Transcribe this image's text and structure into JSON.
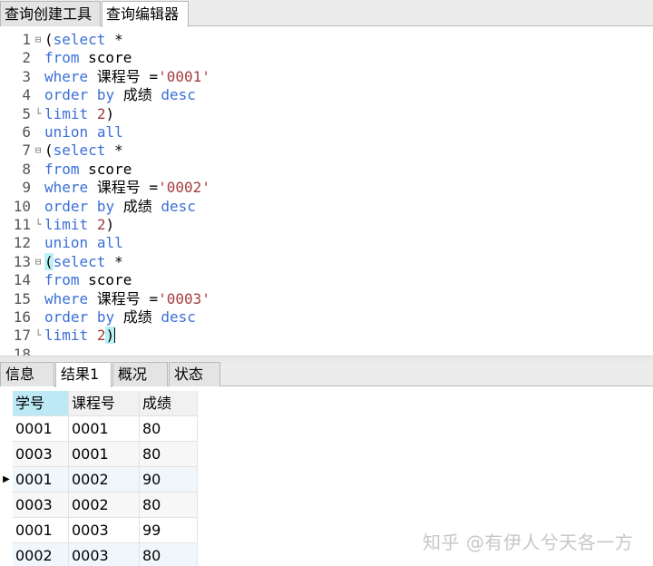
{
  "top_tabs": [
    {
      "label": "查询创建工具",
      "active": false
    },
    {
      "label": "查询编辑器",
      "active": true
    }
  ],
  "editor": {
    "lines": [
      {
        "n": "1",
        "fold": "⊟",
        "segs": [
          [
            "p",
            "("
          ],
          [
            "kw",
            "select"
          ],
          [
            "p",
            " *"
          ]
        ]
      },
      {
        "n": "2",
        "fold": "",
        "segs": [
          [
            "kw",
            "from"
          ],
          [
            "p",
            " score"
          ]
        ]
      },
      {
        "n": "3",
        "fold": "",
        "segs": [
          [
            "kw",
            "where"
          ],
          [
            "p",
            " 课程号 ="
          ],
          [
            "str",
            "'0001'"
          ]
        ]
      },
      {
        "n": "4",
        "fold": "",
        "segs": [
          [
            "kw",
            "order"
          ],
          [
            "p",
            " "
          ],
          [
            "kw",
            "by"
          ],
          [
            "p",
            " 成绩 "
          ],
          [
            "kw",
            "desc"
          ]
        ]
      },
      {
        "n": "5",
        "fold": "└",
        "segs": [
          [
            "kw",
            "limit"
          ],
          [
            "p",
            " "
          ],
          [
            "num",
            "2"
          ],
          [
            "p",
            ")"
          ]
        ]
      },
      {
        "n": "6",
        "fold": "",
        "segs": [
          [
            "kw",
            "union"
          ],
          [
            "p",
            " "
          ],
          [
            "kw",
            "all"
          ]
        ]
      },
      {
        "n": "7",
        "fold": "⊟",
        "segs": [
          [
            "p",
            "("
          ],
          [
            "kw",
            "select"
          ],
          [
            "p",
            " *"
          ]
        ]
      },
      {
        "n": "8",
        "fold": "",
        "segs": [
          [
            "kw",
            "from"
          ],
          [
            "p",
            " score"
          ]
        ]
      },
      {
        "n": "9",
        "fold": "",
        "segs": [
          [
            "kw",
            "where"
          ],
          [
            "p",
            " 课程号 ="
          ],
          [
            "str",
            "'0002'"
          ]
        ]
      },
      {
        "n": "10",
        "fold": "",
        "segs": [
          [
            "kw",
            "order"
          ],
          [
            "p",
            " "
          ],
          [
            "kw",
            "by"
          ],
          [
            "p",
            " 成绩 "
          ],
          [
            "kw",
            "desc"
          ]
        ]
      },
      {
        "n": "11",
        "fold": "└",
        "segs": [
          [
            "kw",
            "limit"
          ],
          [
            "p",
            " "
          ],
          [
            "num",
            "2"
          ],
          [
            "p",
            ")"
          ]
        ]
      },
      {
        "n": "12",
        "fold": "",
        "segs": [
          [
            "kw",
            "union"
          ],
          [
            "p",
            " "
          ],
          [
            "kw",
            "all"
          ]
        ]
      },
      {
        "n": "13",
        "fold": "⊟",
        "segs": [
          [
            "hl",
            "("
          ],
          [
            "kw",
            "select"
          ],
          [
            "p",
            " *"
          ]
        ]
      },
      {
        "n": "14",
        "fold": "",
        "segs": [
          [
            "kw",
            "from"
          ],
          [
            "p",
            " score"
          ]
        ]
      },
      {
        "n": "15",
        "fold": "",
        "segs": [
          [
            "kw",
            "where"
          ],
          [
            "p",
            " 课程号 ="
          ],
          [
            "str",
            "'0003'"
          ]
        ]
      },
      {
        "n": "16",
        "fold": "",
        "segs": [
          [
            "kw",
            "order"
          ],
          [
            "p",
            " "
          ],
          [
            "kw",
            "by"
          ],
          [
            "p",
            " 成绩 "
          ],
          [
            "kw",
            "desc"
          ]
        ]
      },
      {
        "n": "17",
        "fold": "└",
        "segs": [
          [
            "kw",
            "limit"
          ],
          [
            "p",
            " "
          ],
          [
            "num",
            "2"
          ],
          [
            "hl",
            ")"
          ],
          [
            "caret",
            ""
          ]
        ]
      },
      {
        "n": "18",
        "fold": "",
        "segs": []
      }
    ]
  },
  "bottom_tabs": [
    {
      "label": "信息",
      "active": false
    },
    {
      "label": "结果1",
      "active": true
    },
    {
      "label": "概况",
      "active": false
    },
    {
      "label": "状态",
      "active": false
    }
  ],
  "result": {
    "columns": [
      "学号",
      "课程号",
      "成绩"
    ],
    "rows": [
      [
        "0001",
        "0001",
        "80"
      ],
      [
        "0003",
        "0001",
        "80"
      ],
      [
        "0001",
        "0002",
        "90"
      ],
      [
        "0003",
        "0002",
        "80"
      ],
      [
        "0001",
        "0003",
        "99"
      ],
      [
        "0002",
        "0003",
        "80"
      ]
    ],
    "current_row_marker": "▶"
  },
  "watermark": "知乎 @有伊人兮天各一方"
}
